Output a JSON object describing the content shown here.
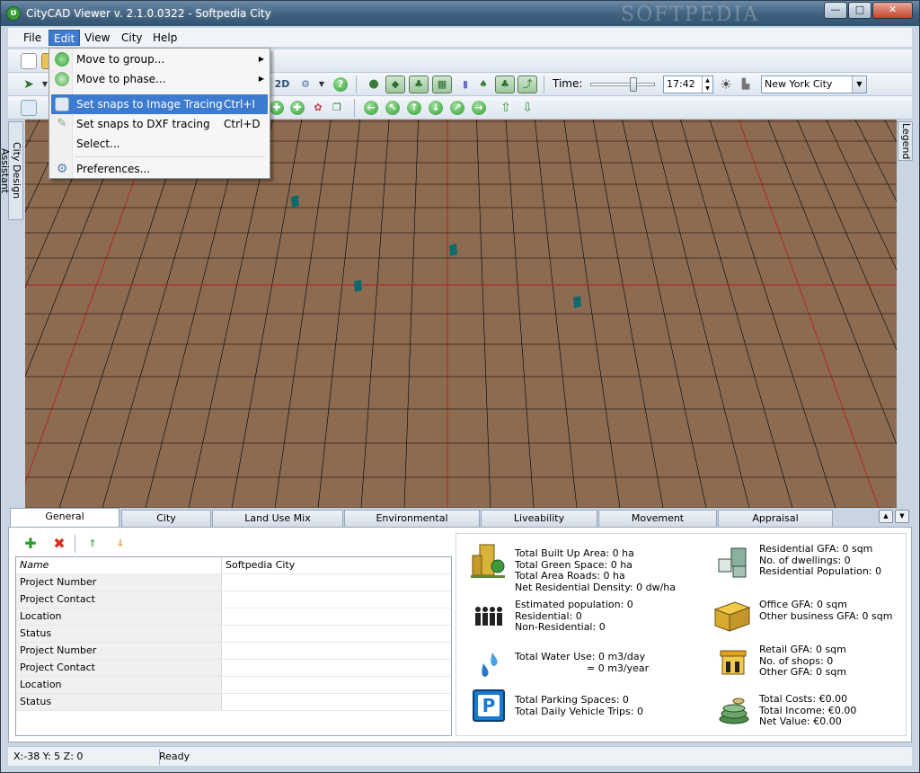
{
  "window": {
    "title": "CityCAD Viewer v. 2.1.0.0322 - Softpedia City",
    "watermark": "SOFTPEDIA",
    "min_symbol": "—",
    "max_symbol": "□",
    "close_symbol": "✕"
  },
  "menubar": {
    "items": [
      {
        "label": "File"
      },
      {
        "label": "Edit"
      },
      {
        "label": "View"
      },
      {
        "label": "City"
      },
      {
        "label": "Help"
      }
    ]
  },
  "toolbar": {
    "time_label": "Time:",
    "time_value": "17:42",
    "city_value": "New York City",
    "time_slider_fraction": 0.65,
    "view_2d_label": "2D"
  },
  "side_tabs": {
    "left": "City Design Assistant",
    "right": "Legend"
  },
  "edit_menu": {
    "items": [
      {
        "label": "Move to group...",
        "shortcut": "",
        "submenu": true
      },
      {
        "label": "Move to phase...",
        "shortcut": "",
        "submenu": true
      },
      {
        "label": "Set snaps to Image Tracing",
        "shortcut": "Ctrl+I"
      },
      {
        "label": "Set snaps to DXF tracing",
        "shortcut": "Ctrl+D"
      },
      {
        "label": "Select...",
        "shortcut": ""
      },
      {
        "label": "Preferences...",
        "shortcut": ""
      }
    ]
  },
  "tabs": [
    {
      "label": "General"
    },
    {
      "label": "City"
    },
    {
      "label": "Land Use Mix"
    },
    {
      "label": "Environmental"
    },
    {
      "label": "Liveability"
    },
    {
      "label": "Movement"
    },
    {
      "label": "Appraisal"
    }
  ],
  "properties": [
    {
      "key": "Name",
      "value": "Softpedia City"
    },
    {
      "key": "Project Number",
      "value": ""
    },
    {
      "key": "Project Contact",
      "value": ""
    },
    {
      "key": "Location",
      "value": ""
    },
    {
      "key": "Status",
      "value": ""
    },
    {
      "key": "Project Number",
      "value": ""
    },
    {
      "key": "Project Contact",
      "value": ""
    },
    {
      "key": "Location",
      "value": ""
    },
    {
      "key": "Status",
      "value": ""
    }
  ],
  "stats": {
    "area": [
      "Total Built Up Area: 0 ha",
      "Total Green Space: 0 ha",
      "Total Area Roads: 0 ha",
      "Net Residential Density: 0 dw/ha"
    ],
    "population": [
      "Estimated population: 0",
      "Residential: 0",
      "Non-Residential: 0"
    ],
    "water": [
      "Total Water Use: 0 m3/day",
      "= 0 m3/year"
    ],
    "parking": [
      "Total Parking Spaces: 0",
      "Total Daily Vehicle Trips: 0"
    ],
    "residential": [
      "Residential GFA: 0 sqm",
      "No. of dwellings: 0",
      "Residential Population: 0"
    ],
    "office": [
      "Office GFA: 0 sqm",
      "Other business GFA: 0 sqm"
    ],
    "retail": [
      "Retail GFA: 0 sqm",
      "No. of shops: 0",
      "Other GFA: 0 sqm"
    ],
    "costs": [
      "Total Costs: €0.00",
      "Total Income: €0.00",
      "Net Value: €0.00"
    ],
    "parking_sign": "P"
  },
  "statusbar": {
    "coords": "X:-38 Y: 5 Z: 0",
    "status": "Ready"
  },
  "colors": {
    "ground": "#8d6b50",
    "grid_line": "#000000",
    "grid_major": "#b22222",
    "marker": "#0f6b6b",
    "menu_highlight": "#3d7bd0"
  }
}
